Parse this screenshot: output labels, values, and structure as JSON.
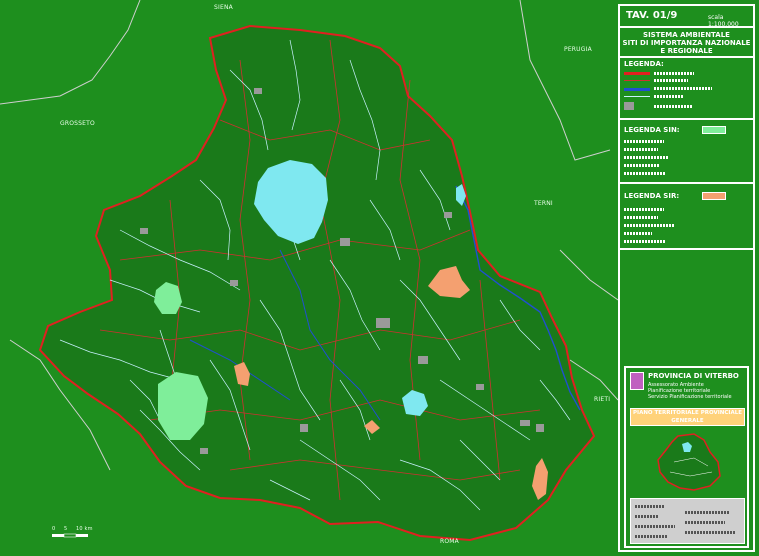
{
  "panel": {
    "tav": "TAV. 01/9",
    "scala": "scala 1:100.000",
    "title": [
      "SISTEMA AMBIENTALE",
      "SITI DI IMPORTANZA NAZIONALE",
      "E REGIONALE"
    ],
    "legenda": "LEGENDA:",
    "legenda_sin": "LEGENDA SIN:",
    "legenda_sir": "LEGENDA SIR:",
    "province": {
      "title": "PROVINCIA DI VITERBO",
      "sub": [
        "Assessorato Ambiente",
        "Pianificazione territoriale",
        "Servizio Pianificazione territoriale"
      ],
      "plan": [
        "PIANO TERRITORIALE PROVINCIALE",
        "GENERALE"
      ]
    }
  },
  "places": {
    "siena": "SIENA",
    "perugia": "PERUGIA",
    "grosseto": "GROSSETO",
    "terni": "TERNI",
    "rieti": "RIETI",
    "roma": "ROMA"
  },
  "scalebar": {
    "t0": "0",
    "t1": "5",
    "t2": "10 km"
  },
  "colors": {
    "background": "#1e8f1e",
    "province_fill": "#1a7a1a",
    "boundary_red": "#e02020",
    "lake": "#7fe8f0",
    "sin": "#7fee9a",
    "sir": "#f4a070",
    "river": "#2050d0",
    "stream": "#c8f2ff"
  }
}
